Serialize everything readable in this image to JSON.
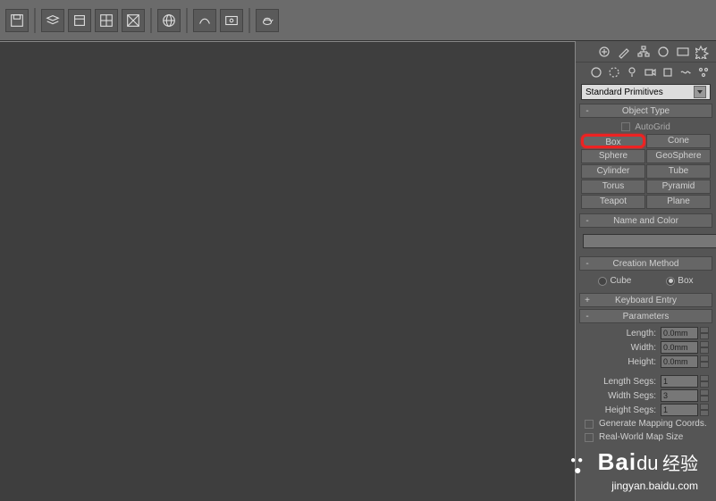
{
  "toolbar": {
    "icons": [
      "save-icon",
      "layers-icon",
      "box-icon",
      "grid-icon",
      "wireframe-icon",
      "globe-icon",
      "spline-icon",
      "render-icon",
      "teapot-icon"
    ]
  },
  "panel": {
    "dropdown": "Standard Primitives",
    "object_type": {
      "header": "Object Type",
      "autogrid": "AutoGrid",
      "buttons": [
        "Box",
        "Cone",
        "Sphere",
        "GeoSphere",
        "Cylinder",
        "Tube",
        "Torus",
        "Pyramid",
        "Teapot",
        "Plane"
      ]
    },
    "name_color": {
      "header": "Name and Color"
    },
    "creation_method": {
      "header": "Creation Method",
      "cube": "Cube",
      "box": "Box"
    },
    "keyboard_entry": {
      "header": "Keyboard Entry"
    },
    "parameters": {
      "header": "Parameters",
      "length": "Length:",
      "width": "Width:",
      "height": "Height:",
      "length_segs": "Length Segs:",
      "width_segs": "Width Segs:",
      "height_segs": "Height Segs:",
      "gen_coords": "Generate Mapping Coords.",
      "real_world": "Real-World Map Size",
      "val_zero": "0.0mm",
      "val_one": "1",
      "val_three": "3"
    }
  },
  "watermark": {
    "main": "Bai",
    "sub": "经验",
    "url": "jingyan.baidu.com"
  }
}
